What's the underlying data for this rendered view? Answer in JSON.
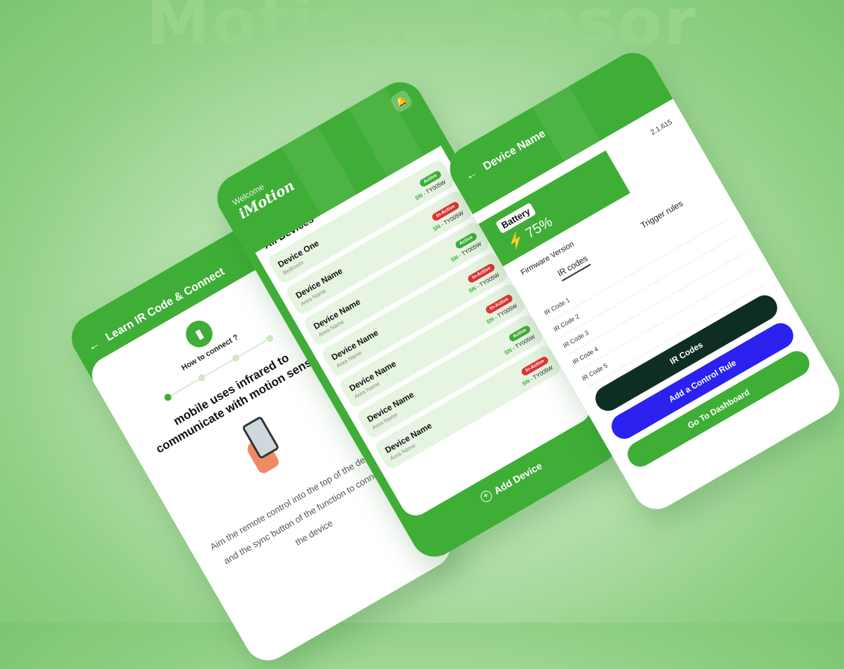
{
  "hero_title": "Motion Sensor",
  "learn_screen": {
    "title": "Learn IR Code & Connect",
    "back": "←",
    "how_to": "How to connect ?",
    "headline": "mobile uses infrared to communicate with motion sensor",
    "instructions": "Aim the remote control into the top of the device and the sync button of the function to connect the device"
  },
  "devices_screen": {
    "welcome": "Welcome",
    "brand": "iMotion",
    "section_title": "All Devices",
    "add_device": "Add Device",
    "devices": [
      {
        "name": "Device One",
        "area": "Bedroom",
        "status": "Active",
        "sn_prefix": "SN",
        "sn": "TY005W"
      },
      {
        "name": "Device Name",
        "area": "Area Name",
        "status": "In-Active",
        "sn_prefix": "SN",
        "sn": "TY005W"
      },
      {
        "name": "Device Name",
        "area": "Area Name",
        "status": "Active",
        "sn_prefix": "SN",
        "sn": "TY005W"
      },
      {
        "name": "Device Name",
        "area": "Area Name",
        "status": "In-Active",
        "sn_prefix": "SN",
        "sn": "TY005W"
      },
      {
        "name": "Device Name",
        "area": "Area Name",
        "status": "In-Active",
        "sn_prefix": "SN",
        "sn": "TY005W"
      },
      {
        "name": "Device Name",
        "area": "Area Name",
        "status": "Active",
        "sn_prefix": "SN",
        "sn": "TY005W"
      },
      {
        "name": "Device Name",
        "area": "Area Name",
        "status": "In-Active",
        "sn_prefix": "SN",
        "sn": "TY005W"
      }
    ]
  },
  "detail_screen": {
    "title": "Device Name",
    "back": "←",
    "battery_label": "Battery",
    "battery_value": "75%",
    "firmware_number": "2.1.615",
    "firmware_label": "Firmware Version",
    "tabs": [
      "IR codes",
      "Trigger rules"
    ],
    "active_tab": "IR codes",
    "ir_codes": [
      "IR Code 1",
      "IR Code 2",
      "IR Code 3",
      "IR Code 4",
      "IR Code 5"
    ],
    "buttons": {
      "ir_codes": "IR Codes",
      "add_rule": "Add a Control Rule",
      "dashboard": "Go To Dashboard"
    }
  },
  "colors": {
    "brand_green": "#3fae36",
    "inactive_red": "#e03333",
    "rule_blue": "#2b22f0",
    "dark": "#0f2e22"
  }
}
